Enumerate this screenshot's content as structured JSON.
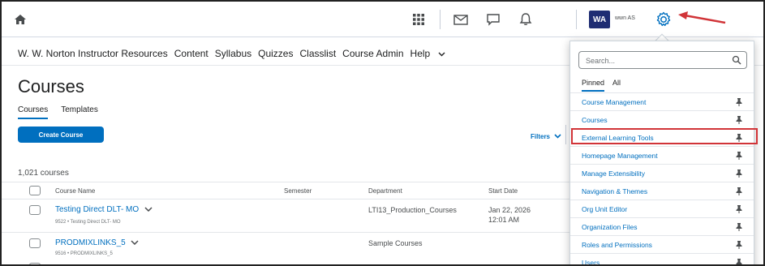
{
  "topbar": {
    "icons": [
      "home-icon",
      "apps-grid-icon",
      "email-icon",
      "chat-icon",
      "notification-bell-icon",
      "gear-icon"
    ],
    "avatar_initials": "WA",
    "username": "wwn AS"
  },
  "nav": {
    "items": [
      "W. W. Norton Instructor Resources",
      "Content",
      "Syllabus",
      "Quizzes",
      "Classlist",
      "Course Admin",
      "Help"
    ]
  },
  "page": {
    "title": "Courses",
    "tabs": [
      "Courses",
      "Templates"
    ],
    "create_button": "Create Course",
    "filters_label": "Filters",
    "course_count": "1,021 courses"
  },
  "table": {
    "headers": [
      "Course Name",
      "Semester",
      "Department",
      "Start Date"
    ],
    "rows": [
      {
        "name": "Testing Direct DLT- MO",
        "sub": "9522 • Testing Direct DLT- MO",
        "semester": "",
        "department": "LTI13_Production_Courses",
        "start_date": "Jan 22, 2026",
        "start_time": "12:01 AM"
      },
      {
        "name": "PRODMIXLINKS_5",
        "sub": "9516 • PRODMIXLINKS_5",
        "semester": "",
        "department": "Sample Courses",
        "start_date": "",
        "start_time": ""
      }
    ]
  },
  "admin_menu": {
    "search_placeholder": "Search...",
    "tabs": [
      "Pinned",
      "All"
    ],
    "items": [
      "Course Management",
      "Courses",
      "External Learning Tools",
      "Homepage Management",
      "Manage Extensibility",
      "Navigation & Themes",
      "Org Unit Editor",
      "Organization Files",
      "Roles and Permissions",
      "Users"
    ],
    "highlighted_item": "External Learning Tools"
  },
  "colors": {
    "link": "#006fbf",
    "avatar": "#1f2d73",
    "highlight": "#d13438"
  }
}
